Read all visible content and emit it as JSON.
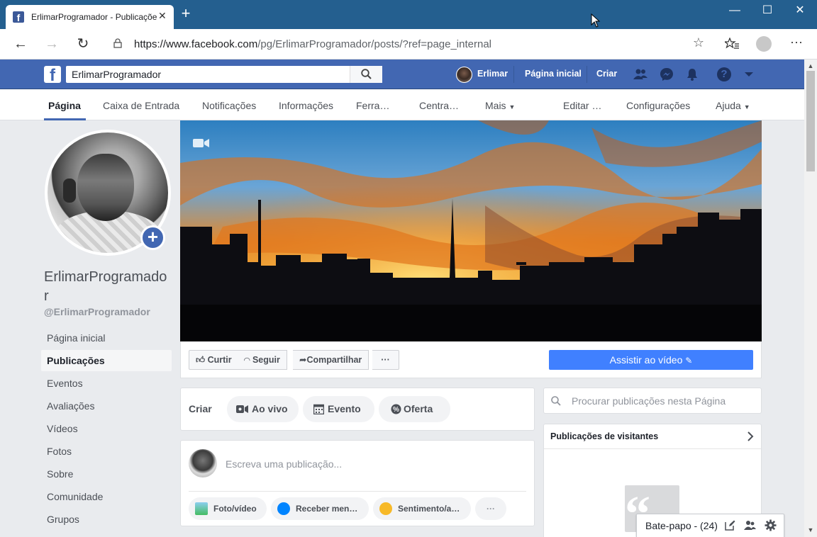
{
  "browser": {
    "tab_title": "ErlimarProgramador - Publicaçõe",
    "favicon": "f",
    "new_tab": "+",
    "url_host": "https://www.facebook.com",
    "url_path": "/pg/ErlimarProgramador/posts/?ref=page_internal"
  },
  "fb_header": {
    "logo": "f",
    "search_value": "ErlimarProgramador",
    "user_name": "Erlimar",
    "home": "Página inicial",
    "create": "Criar",
    "brand_color": "#4267b2"
  },
  "page_nav": {
    "items": [
      "Página",
      "Caixa de Entrada",
      "Notificações",
      "Informações",
      "Ferra…",
      "Centra…",
      "Mais",
      "Editar …",
      "Configurações",
      "Ajuda"
    ]
  },
  "profile": {
    "name": "ErlimarProgramador",
    "handle": "@ErlimarProgramador",
    "add_icon": "+"
  },
  "left_nav": {
    "items": [
      "Página inicial",
      "Publicações",
      "Eventos",
      "Avaliações",
      "Vídeos",
      "Fotos",
      "Sobre",
      "Comunidade",
      "Grupos"
    ],
    "active": "Publicações"
  },
  "page_actions": {
    "like": "Curtir",
    "follow": "Seguir",
    "share": "Compartilhar",
    "more": "···",
    "watch_video": "Assistir ao vídeo"
  },
  "create_post": {
    "label": "Criar",
    "live": "Ao vivo",
    "event": "Evento",
    "offer": "Oferta",
    "placeholder": "Escreva uma publicação...",
    "photo": "Foto/vídeo",
    "messages": "Receber men…",
    "feeling": "Sentimento/a…",
    "more": "···"
  },
  "right_col": {
    "search_placeholder": "Procurar publicações nesta Página",
    "visitor_posts": "Publicações de visitantes"
  },
  "chat": {
    "label": "Bate-papo - (24)"
  }
}
